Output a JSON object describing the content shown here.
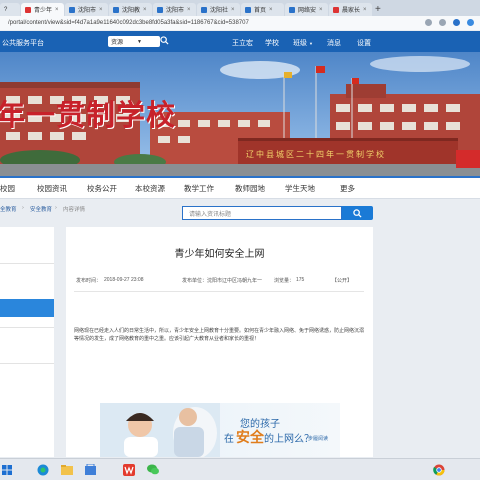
{
  "browser": {
    "tabs": [
      {
        "label": "青少年",
        "color": "#d33"
      },
      {
        "label": "沈阳市",
        "color": "#2a72c9"
      },
      {
        "label": "沈阳教",
        "color": "#2a72c9"
      },
      {
        "label": "沈阳市",
        "color": "#2a72c9"
      },
      {
        "label": "沈阳社",
        "color": "#2a72c9"
      },
      {
        "label": "首页",
        "color": "#2a72c9"
      },
      {
        "label": "网络安",
        "color": "#2a72c9"
      },
      {
        "label": "晨家长",
        "color": "#d33"
      }
    ],
    "first_tab_partial": "?",
    "new_tab_glyph": "+",
    "url": "/portal/content/view&sid=f4d7a1a9e11640c092dc3be8fd05a3fa&sid=1186767&cid=538707"
  },
  "site": {
    "platform_name": "公共服务平台",
    "select_value": "资源",
    "links": [
      "王立宏",
      "学校",
      "班级",
      "消息",
      "设置"
    ]
  },
  "banner": {
    "school_name": "年一贯制学校",
    "gate_text": "辽中县城区二十四年一贯制学校"
  },
  "nav": {
    "items": [
      "校园",
      "校园资讯",
      "校务公开",
      "本校资源",
      "教学工作",
      "教师园地",
      "学生天地",
      "更多"
    ]
  },
  "breadcrumb": [
    "全教育",
    "安全教育",
    "内容详情"
  ],
  "search": {
    "placeholder": "请输入资讯标题"
  },
  "article": {
    "title": "青少年如何安全上网",
    "published_label": "发布时间：",
    "published": "2018-09-27 23:08",
    "unit_label": "发布单位：",
    "unit": "沈阳市辽中区冯朝九年一",
    "views_label": "浏览量：",
    "views": "175",
    "visibility": "【公开】",
    "body": "网络现在已经走入人们的日常生活中，所以，青少年安全上网教育十分重要。如何在青少年融入网络、免于网络诱惑，防止网络沉溺等情况的发生，成了网络教育的重中之重。应该引起广大教育从业者和家长的重视！"
  },
  "promo": {
    "line1": "您的孩子",
    "line2_pre": "在",
    "line2_highlight": "安全",
    "line2_post": "的上网么？",
    "line3": "步履阅读"
  },
  "taskbar": {
    "icons": [
      "windows-icon",
      "edge-icon",
      "folder-icon",
      "store-icon",
      "wps-icon",
      "wechat-icon",
      "chrome-icon"
    ]
  }
}
